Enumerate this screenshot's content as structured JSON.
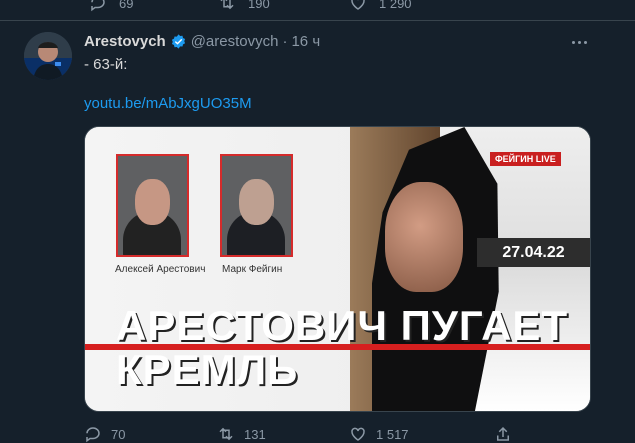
{
  "previous_tweet": {
    "reply_count": "69",
    "retweet_count": "190",
    "like_count": "1 290"
  },
  "tweet": {
    "name": "Arestovych",
    "handle": "@arestovych",
    "separator": "·",
    "time": "16 ч",
    "text": "- 63-й:",
    "link": "youtu.be/mAbJxgUO35M",
    "stats": {
      "replies": "70",
      "retweets": "131",
      "likes": "1 517"
    }
  },
  "thumbnail": {
    "left_person": "Алексей Арестович",
    "right_person": "Марк Фейгин",
    "brand": "ФЕЙГИН LIVE",
    "date": "27.04.22",
    "headline_line1": "АРЕСТОВИЧ ПУГАЕТ",
    "headline_line2": "КРЕМЛЬ"
  },
  "icons": {
    "verified": "verified-badge-icon",
    "more": "more-options-icon",
    "reply": "reply-icon",
    "retweet": "retweet-icon",
    "like": "like-icon",
    "share": "share-icon"
  },
  "colors": {
    "background": "#15202b",
    "link": "#1d9bf0",
    "muted_text": "#8b98a5",
    "thumbnail_red": "#d61f1f"
  }
}
